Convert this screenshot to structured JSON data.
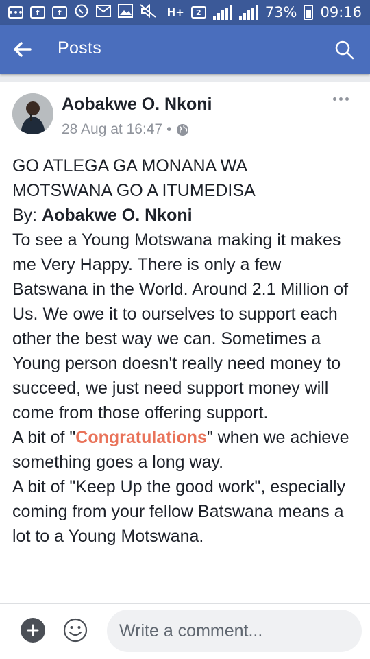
{
  "status_bar": {
    "sim_label": "2",
    "network_label": "H+",
    "battery_percent": "73%",
    "time": "09:16",
    "icons": [
      "messenger-icon",
      "facebook-icon",
      "facebook-icon",
      "whatsapp-icon",
      "mail-icon",
      "gallery-icon",
      "mute-icon"
    ]
  },
  "header": {
    "title": "Posts"
  },
  "post": {
    "author": "Aobakwe O. Nkoni",
    "date": "28 Aug at 16:47",
    "separator": "•",
    "title_line1": "GO ATLEGA GA MONANA WA",
    "title_line2": "MOTSWANA GO A ITUMEDISA",
    "by_label": "By: ",
    "by_name": "Aobakwe O. Nkoni",
    "paragraph1": "To see a Young Motswana making it makes me Very Happy. There is only a few Batswana in the World. Around 2.1 Million of Us. We owe it to ourselves to support each other the best way we can. Sometimes a Young person doesn't really need money to succeed, we just need support money will come from those offering support.",
    "para2_prefix": "A bit of \"",
    "para2_highlight": "Congratulations",
    "para2_suffix": "\" when we achieve something goes a long way.",
    "paragraph3": "A bit of \"Keep Up the good work\", especially coming from your fellow Batswana means a lot to a Young Motswana."
  },
  "comment_bar": {
    "placeholder": "Write a comment..."
  },
  "colors": {
    "status_bar": "#3b5998",
    "app_bar": "#4a6ebd",
    "highlight": "#e9735a"
  }
}
